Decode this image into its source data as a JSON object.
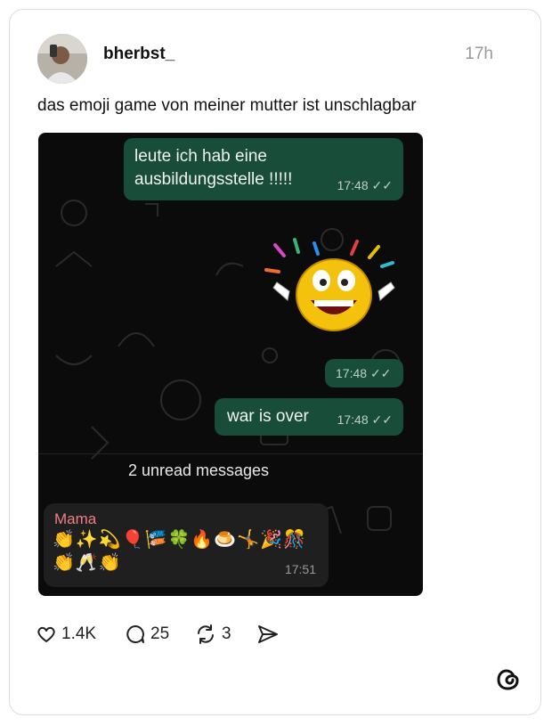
{
  "post": {
    "username": "bherbst_",
    "time": "17h",
    "caption": "das emoji game von meiner mutter ist unschlagbar"
  },
  "chat": {
    "msg1": {
      "text": "leute ich hab eine\nausbildungsstelle !!!!!",
      "time": "17:48"
    },
    "msg2": {
      "time": "17:48"
    },
    "msg3": {
      "text": "war is over",
      "time": "17:48"
    },
    "unread_label": "2 unread messages",
    "incoming": {
      "sender": "Mama",
      "emojis": "👏✨💫🎈🎏🍀🔥🍮🤸🎉🎊👏🥂👏",
      "time": "17:51"
    }
  },
  "actions": {
    "likes": "1.4K",
    "comments": "25",
    "reposts": "3"
  },
  "colors": {
    "bubble_green": "#174d39",
    "sender_pink": "#ef7f86"
  },
  "icons": [
    "heart-icon",
    "comment-icon",
    "repost-icon",
    "share-icon",
    "threads-logo-icon",
    "double-check-icon",
    "laughing-emoji-sticker"
  ]
}
